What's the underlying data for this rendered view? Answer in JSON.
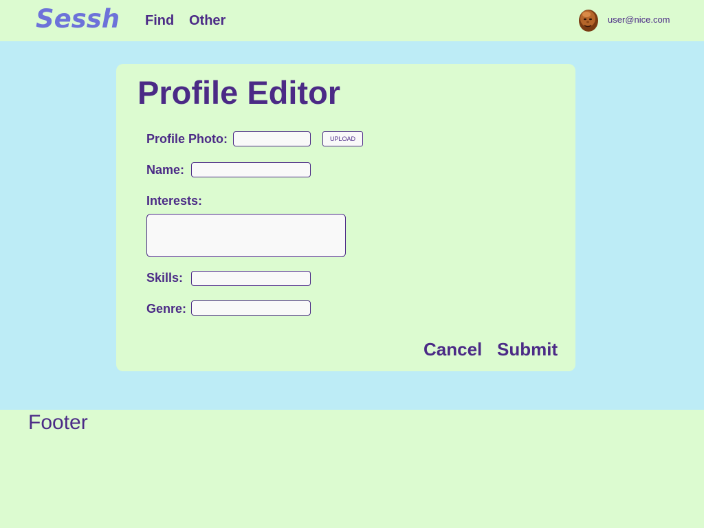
{
  "header": {
    "logo": "Sessh",
    "nav": [
      {
        "label": "Find"
      },
      {
        "label": "Other"
      }
    ],
    "user_email": "user@nice.com",
    "avatar_icon": "user-avatar"
  },
  "form": {
    "title": "Profile Editor",
    "photo_label": "Profile Photo:",
    "photo_value": "",
    "upload_label": "UPLOAD",
    "name_label": "Name:",
    "name_value": "",
    "interests_label": "Interests:",
    "interests_value": "",
    "skills_label": "Skills:",
    "skills_value": "",
    "genre_label": "Genre:",
    "genre_value": "",
    "cancel_label": "Cancel",
    "submit_label": "Submit"
  },
  "footer": {
    "text": "Footer"
  },
  "colors": {
    "header_bg": "#dcfbd0",
    "main_bg": "#bdecf6",
    "text": "#4b2a86",
    "logo": "#6d72d9"
  }
}
